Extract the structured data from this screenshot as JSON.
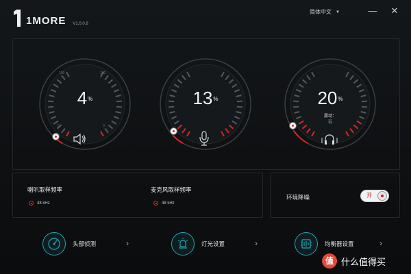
{
  "header": {
    "brand": "1MORE",
    "version": "V1.0.0.8",
    "language": "简体中文",
    "minimize_icon": "minimize-icon",
    "close_icon": "close-icon"
  },
  "gauges": [
    {
      "id": "speaker",
      "value": "4",
      "unit": "%",
      "level": 0.04,
      "tick_top_left": "100",
      "tick_top_right": "100",
      "tick_bottom_left": "0",
      "tick_bottom_right": "0",
      "icon": "speaker-icon",
      "accent": "#e02424"
    },
    {
      "id": "mic",
      "value": "13",
      "unit": "%",
      "level": 0.13,
      "tick_top_left": "",
      "tick_top_right": "",
      "tick_bottom_left": "",
      "tick_bottom_right": "",
      "icon": "microphone-icon",
      "accent": "#e02424"
    },
    {
      "id": "vibration",
      "value": "20",
      "unit": "%",
      "level": 0.2,
      "sub_label": "震动：",
      "sub_value": "弱",
      "tick_top_left": "",
      "tick_top_right": "",
      "tick_bottom_left": "",
      "tick_bottom_right": "",
      "icon": "headphone-vibration-icon",
      "accent": "#e02424"
    }
  ],
  "speaker_rate": {
    "title": "喇叭取样频率",
    "option": "48 kHz"
  },
  "mic_rate": {
    "title": "麦克风取样频率",
    "option": "48 kHz"
  },
  "noise": {
    "title": "环境降噪",
    "toggle_label": "开",
    "state": "on"
  },
  "bottom_nav": [
    {
      "label": "头部侦测",
      "icon": "head-tracking-icon"
    },
    {
      "label": "灯光设置",
      "icon": "light-icon"
    },
    {
      "label": "均衡器设置",
      "icon": "equalizer-icon"
    }
  ],
  "watermark": {
    "badge": "值",
    "text": "什么值得买"
  },
  "colors": {
    "accent": "#e02424",
    "teal": "#1fa8b5",
    "bg": "#0e1012"
  }
}
